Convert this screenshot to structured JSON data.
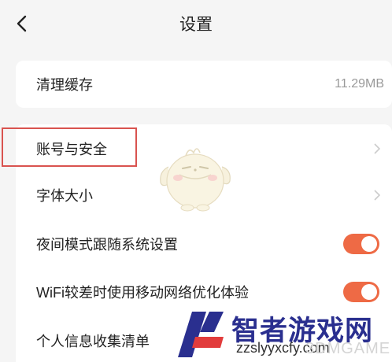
{
  "header": {
    "title": "设置",
    "back_icon": "chevron-left-icon"
  },
  "cache": {
    "label": "清理缓存",
    "value": "11.29MB"
  },
  "settings": {
    "items": [
      {
        "label": "账号与安全",
        "control": "chevron"
      },
      {
        "label": "字体大小",
        "control": "chevron"
      },
      {
        "label": "夜间模式跟随系统设置",
        "control": "toggle",
        "on": true
      },
      {
        "label": "WiFi较差时使用移动网络优化体验",
        "control": "toggle",
        "on": true
      },
      {
        "label": "个人信息收集清单",
        "control": "chevron"
      }
    ]
  },
  "watermark": {
    "site_name": "智者游戏网",
    "url": "zzslyyxcfy.com",
    "brand": "3DMGAME"
  },
  "colors": {
    "toggle_on": "#ee6a45",
    "highlight": "#d9534f",
    "background": "#f5f5f5",
    "chevron": "#cccccc"
  }
}
